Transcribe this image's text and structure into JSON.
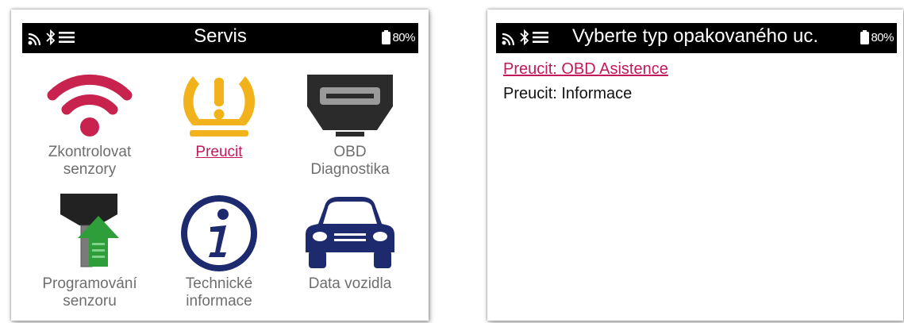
{
  "colors": {
    "accent": "#c2185b",
    "wifi": "#c8234f",
    "tpms": "#f2b21b",
    "obd": "#2b2b2b",
    "info": "#1e2a6e",
    "car": "#1e2a6e",
    "program_arrow": "#2e9e3a"
  },
  "left_screen": {
    "status": {
      "icons": [
        "wifi-icon",
        "bluetooth-icon",
        "menu-icon"
      ],
      "title": "Servis",
      "battery": "80%"
    },
    "tiles": [
      {
        "icon": "wifi-icon",
        "label_1": "Zkontrolovat",
        "label_2": "senzory",
        "selected": false
      },
      {
        "icon": "tpms-warning-icon",
        "label_1": "Preucit",
        "label_2": "",
        "selected": true
      },
      {
        "icon": "obd-connector-icon",
        "label_1": "OBD",
        "label_2": "Diagnostika",
        "selected": false
      },
      {
        "icon": "sensor-program-icon",
        "label_1": "Programování",
        "label_2": "senzoru",
        "selected": false
      },
      {
        "icon": "info-icon",
        "label_1": "Technické",
        "label_2": "informace",
        "selected": false
      },
      {
        "icon": "car-icon",
        "label_1": "Data vozidla",
        "label_2": "",
        "selected": false
      }
    ]
  },
  "right_screen": {
    "status": {
      "icons": [
        "wifi-icon",
        "bluetooth-icon",
        "menu-icon"
      ],
      "title": "Vyberte typ opakovaného uc.",
      "battery": "80%"
    },
    "menu": [
      {
        "label": "Preucit: OBD Asistence ",
        "selected": true
      },
      {
        "label": "Preucit: Informace",
        "selected": false
      }
    ]
  }
}
